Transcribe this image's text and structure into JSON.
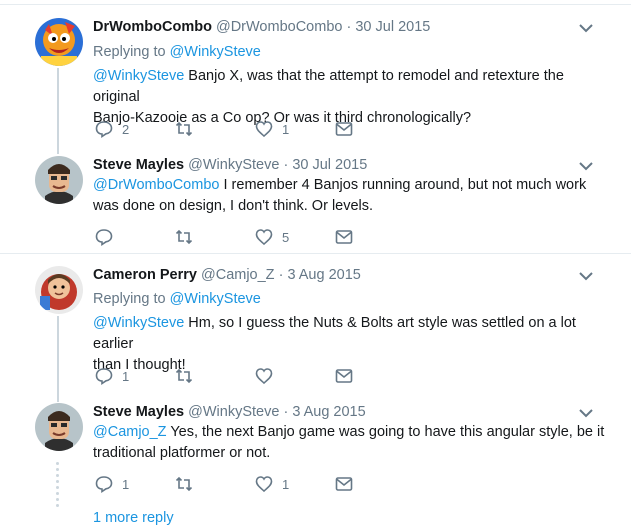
{
  "tweets": [
    {
      "fullname": "DrWomboCombo",
      "handle": "@DrWomboCombo",
      "separator": "·",
      "date": "30 Jul 2015",
      "replying_prefix": "Replying to",
      "replying_to": "@WinkySteve",
      "mention": "@WinkySteve",
      "text_line1": " Banjo X, was that the attempt to remodel and retexture the original",
      "text_line2": "Banjo-Kazooie as a Co op? Or was it third chronologically?",
      "reply_count": "2",
      "retweet_count": "",
      "like_count": "1"
    },
    {
      "fullname": "Steve Mayles",
      "handle": "@WinkySteve",
      "separator": "·",
      "date": "30 Jul 2015",
      "mention": "@DrWomboCombo",
      "text_line1": " I remember 4 Banjos running around, but not much work",
      "text_line2": "was done on design, I don't think. Or levels.",
      "reply_count": "",
      "retweet_count": "",
      "like_count": "5"
    },
    {
      "fullname": "Cameron Perry",
      "handle": "@Camjo_Z",
      "separator": "·",
      "date": "3 Aug 2015",
      "replying_prefix": "Replying to",
      "replying_to": "@WinkySteve",
      "mention": "@WinkySteve",
      "text_line1": " Hm, so I guess the Nuts & Bolts art style was settled on a lot earlier",
      "text_line2": "than I thought!",
      "reply_count": "1",
      "retweet_count": "",
      "like_count": ""
    },
    {
      "fullname": "Steve Mayles",
      "handle": "@WinkySteve",
      "separator": "·",
      "date": "3 Aug 2015",
      "mention": "@Camjo_Z",
      "text_line1": " Yes, the next Banjo game was going to have this angular style, be it",
      "text_line2": "traditional platformer or not.",
      "reply_count": "1",
      "retweet_count": "",
      "like_count": "1"
    }
  ],
  "more_reply": "1 more reply",
  "colors": {
    "link": "#1b95e0",
    "secondary_text": "#657786",
    "primary_text": "#14171a",
    "divider": "#e6ecf0"
  },
  "icons": [
    "reply-icon",
    "retweet-icon",
    "like-icon",
    "message-icon",
    "chevron-down-icon"
  ]
}
